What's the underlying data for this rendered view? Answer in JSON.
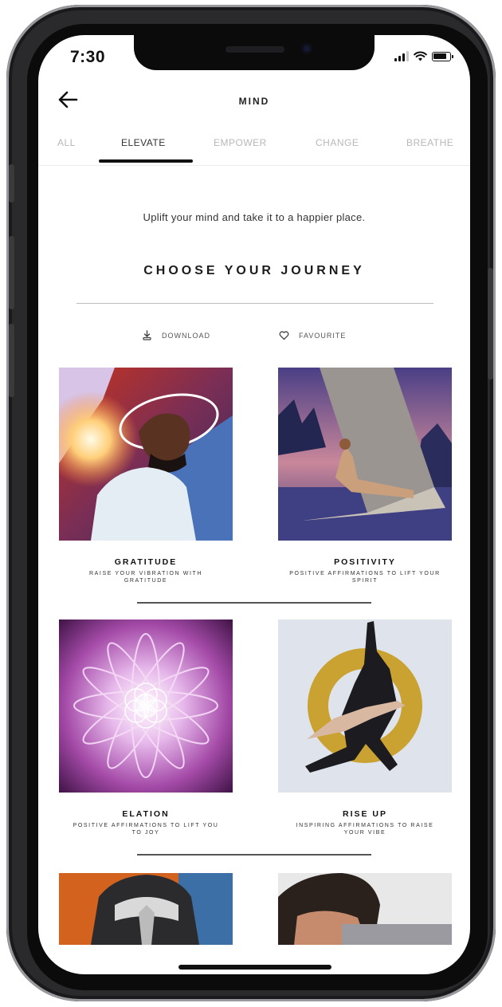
{
  "status_bar": {
    "time": "7:30"
  },
  "header": {
    "title": "MIND"
  },
  "tabs": [
    {
      "label": "ALL",
      "active": false
    },
    {
      "label": "ELEVATE",
      "active": true
    },
    {
      "label": "EMPOWER",
      "active": false
    },
    {
      "label": "CHANGE",
      "active": false
    },
    {
      "label": "BREATHE",
      "active": false
    }
  ],
  "intro": {
    "tagline": "Uplift your mind and take it to a happier place.",
    "heading": "CHOOSE YOUR JOURNEY"
  },
  "filters": {
    "download_label": "DOWNLOAD",
    "favourite_label": "FAVOURITE"
  },
  "journeys": [
    {
      "title": "GRATITUDE",
      "subtitle": "RAISE YOUR VIBRATION WITH GRATITUDE"
    },
    {
      "title": "POSITIVITY",
      "subtitle": "POSITIVE AFFIRMATIONS TO LIFT YOUR SPIRIT"
    },
    {
      "title": "ELATION",
      "subtitle": "POSITIVE AFFIRMATIONS TO LIFT YOU TO JOY"
    },
    {
      "title": "RISE UP",
      "subtitle": "INSPIRING AFFIRMATIONS TO RAISE YOUR VIBE"
    }
  ],
  "colors": {
    "active_tab": "#333333",
    "inactive_tab": "#b8b8b8",
    "underline": "#111111"
  },
  "icons": {
    "back": "arrow-left-icon",
    "download": "download-icon",
    "favourite": "heart-icon"
  }
}
